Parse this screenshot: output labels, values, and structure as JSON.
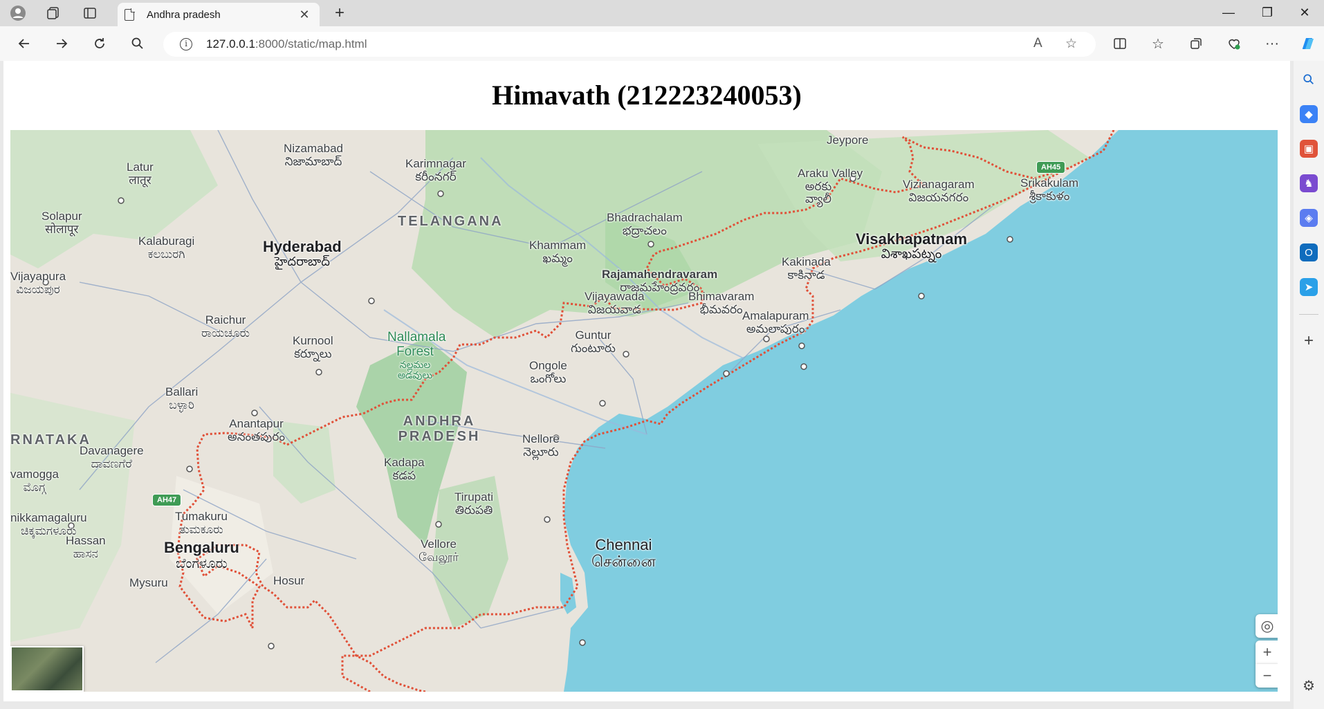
{
  "browser": {
    "tab_title": "Andhra pradesh",
    "tab_close": "✕",
    "new_tab": "+",
    "url_host": "127.0.0.1",
    "url_rest": ":8000/static/map.html",
    "window_controls": {
      "minimize": "—",
      "restore": "❐",
      "close": "✕"
    }
  },
  "page": {
    "title": "Himavath (212223240053)"
  },
  "map": {
    "states": [
      "TELANGANA",
      "ANDHRA PRADESH",
      "RNATAKA"
    ],
    "forest": {
      "name": "Nallamala Forest",
      "local": "నల్లమల అడవులు"
    },
    "highways": [
      "AH45",
      "AH47"
    ],
    "cities": [
      {
        "name": "Nizamabad",
        "local": "నిజామాబాద్"
      },
      {
        "name": "Karimnagar",
        "local": "కరీంనగర్"
      },
      {
        "name": "Latur",
        "local": "लातूर"
      },
      {
        "name": "Solapur",
        "local": "सोलापूर"
      },
      {
        "name": "Kalaburagi",
        "local": "ಕಲಬುರಗಿ"
      },
      {
        "name": "Hyderabad",
        "local": "హైదరాబాద్"
      },
      {
        "name": "Vijayapura",
        "local": "ವಿಜಯಪುರ"
      },
      {
        "name": "Raichur",
        "local": "ರಾಯಚೂರು"
      },
      {
        "name": "Kurnool",
        "local": "కర్నూలు"
      },
      {
        "name": "Ballari",
        "local": "ಬಳ್ಳಾರಿ"
      },
      {
        "name": "Anantapur",
        "local": "అనంతపురం"
      },
      {
        "name": "Davanagere",
        "local": "ದಾವಣಗೆರೆ"
      },
      {
        "name": "vamogga",
        "local": "ಮೊಗ್ಗ"
      },
      {
        "name": "Kadapa",
        "local": "కడప"
      },
      {
        "name": "Tirupati",
        "local": "తిరుపతి"
      },
      {
        "name": "Tumakuru",
        "local": "ತುಮಕೂರು"
      },
      {
        "name": "nikkamagaluru",
        "local": "ಚಿಕ್ಕಮಗಳೂರು"
      },
      {
        "name": "Hassan",
        "local": "ಹಾಸನ"
      },
      {
        "name": "Bengaluru",
        "local": "ಬೆಂಗಳೂರು"
      },
      {
        "name": "Mysuru",
        "local": ""
      },
      {
        "name": "Hosur",
        "local": ""
      },
      {
        "name": "Vellore",
        "local": "வேலூர்"
      },
      {
        "name": "Chennai",
        "local": "சென்னை"
      },
      {
        "name": "Nellore",
        "local": "నెల్లూరు"
      },
      {
        "name": "Ongole",
        "local": "ఒంగోలు"
      },
      {
        "name": "Guntur",
        "local": "గుంటూరు"
      },
      {
        "name": "Khammam",
        "local": "ఖమ్మం"
      },
      {
        "name": "Bhadrachalam",
        "local": "భద్రాచలం"
      },
      {
        "name": "Vijayawada",
        "local": "విజయవాడ"
      },
      {
        "name": "Rajamahendravaram",
        "local": "రాజమహేంద్రవరం"
      },
      {
        "name": "Bhimavaram",
        "local": "భీమవరం"
      },
      {
        "name": "Amalapuram",
        "local": "అమలాపురం"
      },
      {
        "name": "Kakinada",
        "local": "కాకినాడ"
      },
      {
        "name": "Visakhapatnam",
        "local": "విశాఖపట్నం"
      },
      {
        "name": "Araku Valley",
        "local": "అరకు వ్యాలీ"
      },
      {
        "name": "Vizianagaram",
        "local": "విజయనగరం"
      },
      {
        "name": "Srikakulam",
        "local": "శ్రీకాకుళం"
      },
      {
        "name": "Jeypore",
        "local": ""
      }
    ],
    "controls": {
      "zoom_in": "+",
      "zoom_out": "−",
      "locate": "◎"
    }
  }
}
